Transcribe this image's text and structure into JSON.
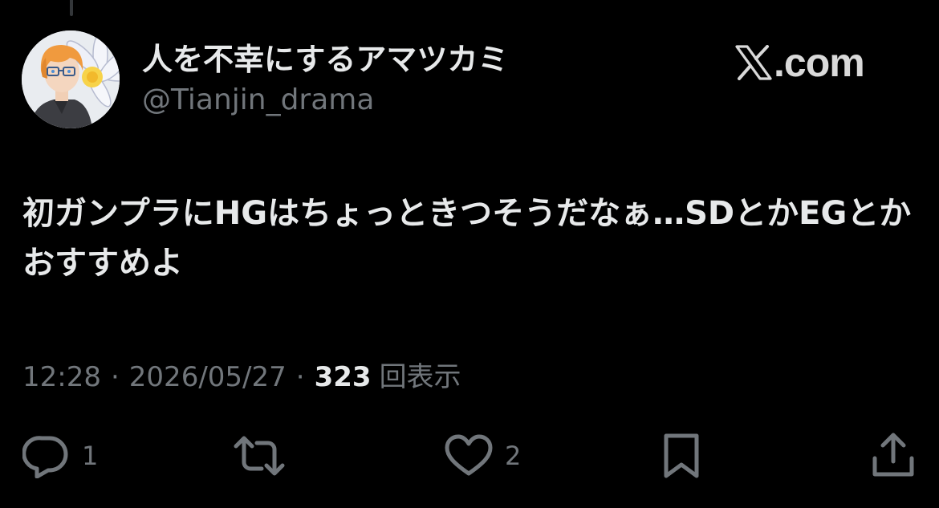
{
  "post": {
    "author": {
      "display_name": "人を不幸にするアマツカミ",
      "handle": "@Tianjin_drama"
    },
    "brand": {
      "text": ".com",
      "icon": "x-logo-icon"
    },
    "text": "初ガンプラにHGはちょっときつそうだなぁ…SDとかEGとかおすすめよ",
    "meta": {
      "time": "12:28",
      "separator": "·",
      "date": "2026/05/27",
      "views_count": "323",
      "views_label": "回表示"
    },
    "actions": {
      "reply": {
        "icon": "reply-icon",
        "count": "1"
      },
      "repost": {
        "icon": "repost-icon",
        "count": ""
      },
      "like": {
        "icon": "heart-icon",
        "count": "2"
      },
      "bookmark": {
        "icon": "bookmark-icon"
      },
      "share": {
        "icon": "share-icon"
      }
    }
  },
  "colors": {
    "background": "#000000",
    "primary_text": "#e7e9ea",
    "secondary_text": "#71767b"
  }
}
